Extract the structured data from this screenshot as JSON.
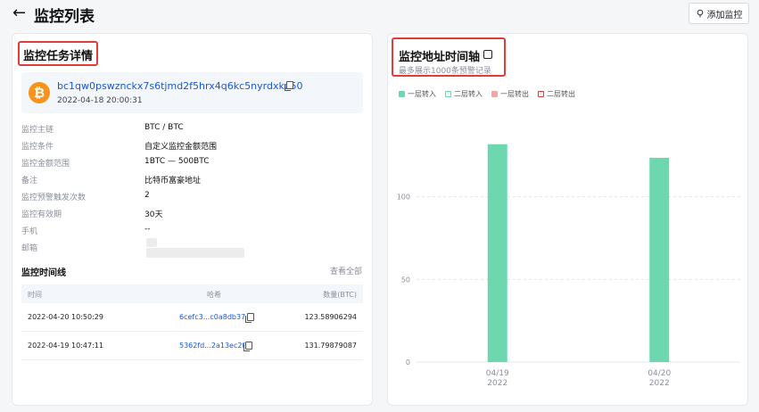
{
  "header": {
    "back_icon": "arrow-left-icon",
    "title": "监控列表",
    "add_button": "添加监控",
    "add_icon": "location-pin-icon"
  },
  "detail": {
    "title": "监控任务详情",
    "address": "bc1qw0pswznckx7s6tjmd2f5hrx4q6kc5nyrdxku50",
    "created": "2022-04-18 20:00:31",
    "rows": [
      {
        "label": "监控主链",
        "value": "BTC / BTC"
      },
      {
        "label": "监控条件",
        "value": "自定义监控金额范围"
      },
      {
        "label": "监控金额范围",
        "value": "1BTC — 500BTC"
      },
      {
        "label": "备注",
        "value": "比特币富豪地址"
      },
      {
        "label": "监控预警触发次数",
        "value": "2"
      },
      {
        "label": "监控有效期",
        "value": "30天"
      },
      {
        "label": "手机",
        "value": "--"
      },
      {
        "label": "邮箱",
        "value": ""
      }
    ]
  },
  "timeline": {
    "title": "监控时间线",
    "view_all": "查看全部",
    "columns": [
      "时间",
      "哈希",
      "数量(BTC)"
    ],
    "rows": [
      {
        "time": "2022-04-20 10:50:29",
        "hash": "6cefc3...c0a8db37",
        "amount": "123.58906294"
      },
      {
        "time": "2022-04-19 10:47:11",
        "hash": "5362fd...2a13ec2f",
        "amount": "131.79879087"
      }
    ]
  },
  "axis_panel": {
    "title": "监控地址时间轴",
    "subtitle": "最多展示1000条预警记录",
    "expand_icon": "expand-icon"
  },
  "chart_data": {
    "type": "bar",
    "categories": [
      "04/19\n2022",
      "04/20\n2022"
    ],
    "series": [
      {
        "name": "一层转入",
        "color": "#6dd8b0",
        "values": [
          131.8,
          123.6
        ]
      },
      {
        "name": "二层转入",
        "color": "#6dd8b0",
        "values": [
          0,
          0
        ]
      },
      {
        "name": "一层转出",
        "color": "#f4a6a6",
        "values": [
          0,
          0
        ]
      },
      {
        "name": "二层转出",
        "color": "#e23b3b",
        "values": [
          0,
          0
        ]
      }
    ],
    "yticks": [
      0,
      50,
      100
    ],
    "ylim": [
      0,
      150
    ],
    "grid": true,
    "legend": "top-left"
  }
}
